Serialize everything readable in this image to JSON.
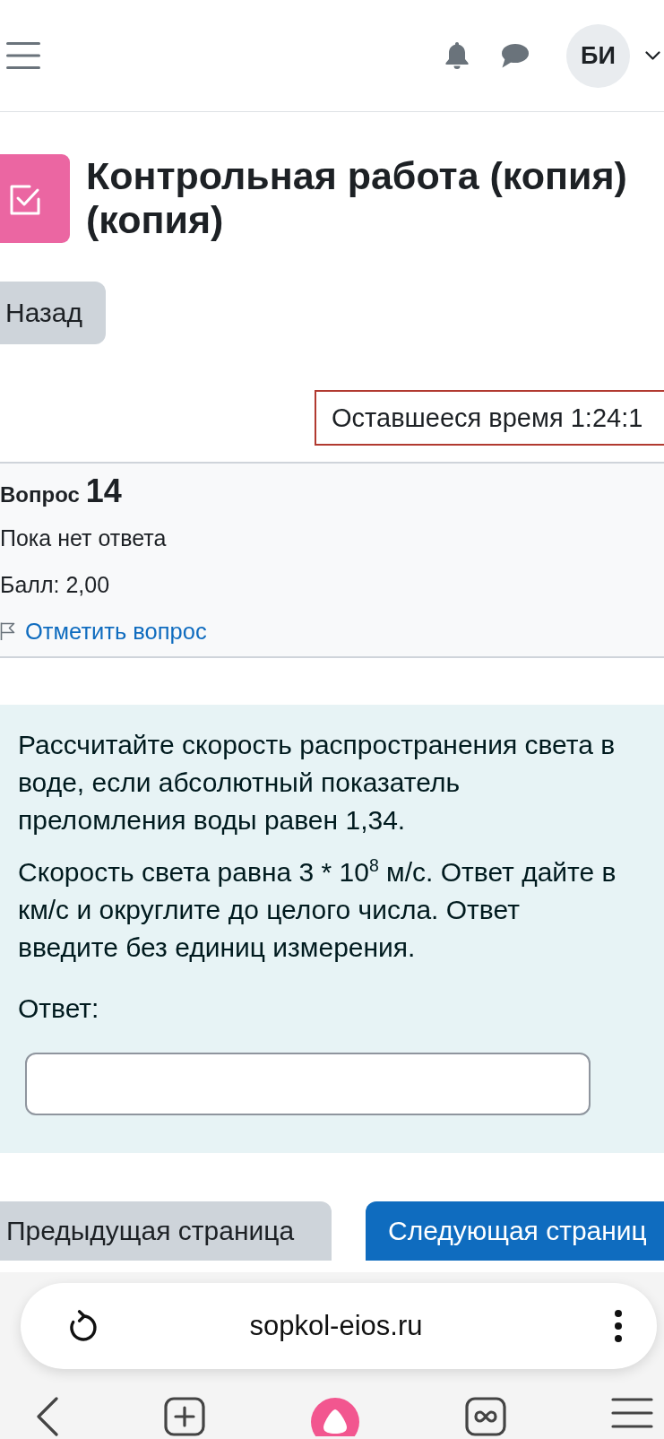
{
  "header": {
    "avatar_initials": "БИ"
  },
  "quiz": {
    "title": "Контрольная работа (копия) (копия)",
    "back_button": "Назад",
    "timer": "Оставшееся время 1:24:1"
  },
  "question_info": {
    "label": "Вопрос",
    "number": "14",
    "status": "Пока нет ответа",
    "grade": "Балл: 2,00",
    "flag_link": "Отметить вопрос"
  },
  "question": {
    "paragraphs": [
      "Рассчитайте скорость распространения света в воде, если абсолютный показатель преломления воды равен 1,34.",
      "Скорость света равна 3 * 10$^{8}$ м/с. Ответ дайте в км/с и округлите до целого числа. Ответ введите без единиц измерения."
    ],
    "answer_label": "Ответ:"
  },
  "navigation": {
    "buttons": [
      {
        "label": "Предыдущая страница",
        "kind": "secondary"
      },
      {
        "label": "Следующая страниц",
        "kind": "primary"
      }
    ]
  },
  "browser": {
    "url": "sopkol-eios.ru"
  }
}
